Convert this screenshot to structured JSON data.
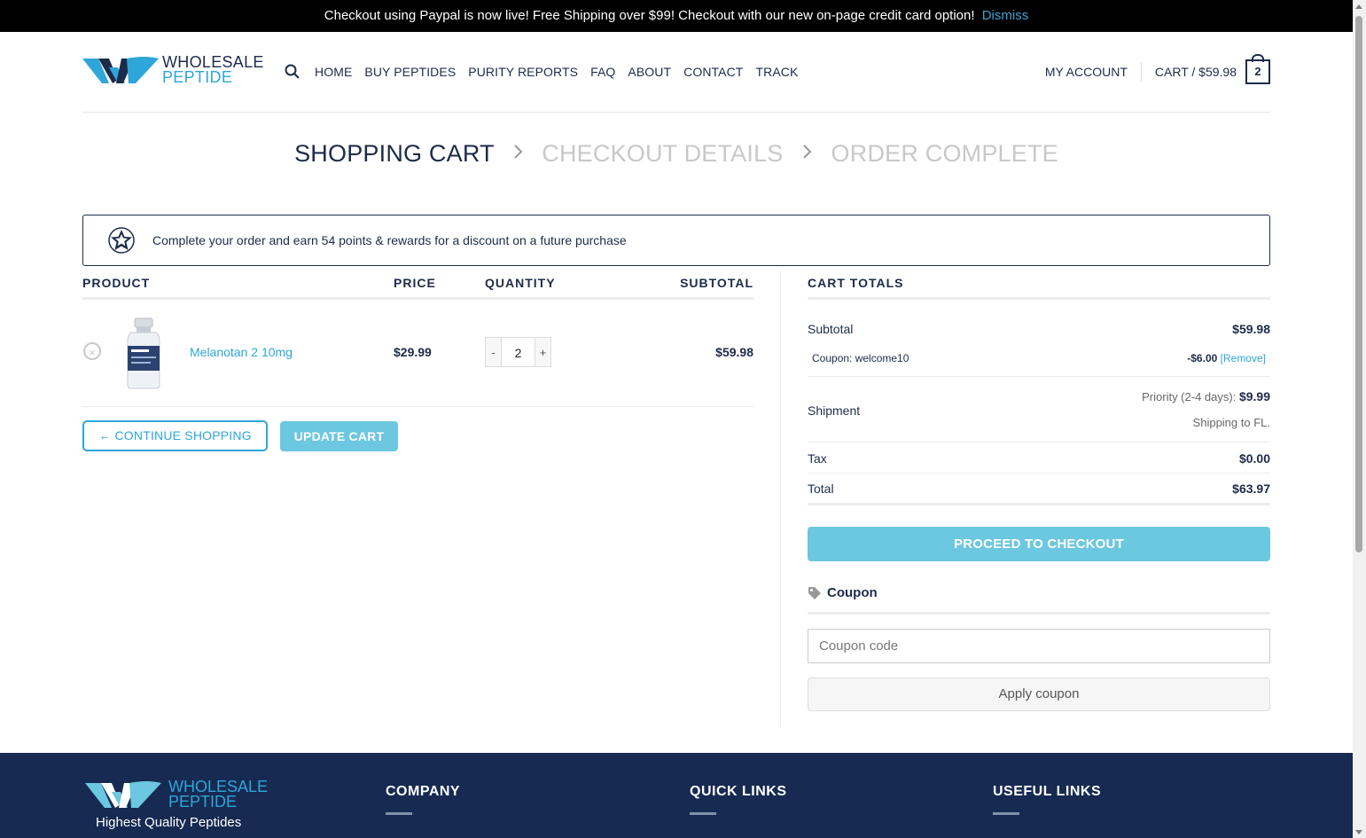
{
  "notice": {
    "text": "Checkout using Paypal is now live! Free Shipping over $99! Checkout with our new on-page credit card option!",
    "dismiss": "Dismiss"
  },
  "brand": {
    "line1": "WHOLESALE",
    "line2": "PEPTIDE"
  },
  "nav": {
    "items": [
      "HOME",
      "BUY PEPTIDES",
      "PURITY REPORTS",
      "FAQ",
      "ABOUT",
      "CONTACT",
      "TRACK"
    ],
    "account": "MY ACCOUNT",
    "cart": "CART / $59.98",
    "cart_count": "2"
  },
  "steps": {
    "step1": "SHOPPING CART",
    "step2": "CHECKOUT DETAILS",
    "step3": "ORDER COMPLETE",
    "separator": ">"
  },
  "rewards": {
    "text": "Complete your order and earn 54 points & rewards for a discount on a future purchase"
  },
  "cart": {
    "headers": {
      "product": "PRODUCT",
      "price": "PRICE",
      "quantity": "QUANTITY",
      "subtotal": "SUBTOTAL"
    },
    "items": [
      {
        "name": "Melanotan 2 10mg",
        "price": "$29.99",
        "qty": "2",
        "subtotal": "$59.98"
      }
    ],
    "qty_minus": "-",
    "qty_plus": "+",
    "remove_symbol": "×",
    "continue_label": "← CONTINUE SHOPPING",
    "update_label": "UPDATE CART"
  },
  "totals": {
    "heading": "CART TOTALS",
    "subtotal_label": "Subtotal",
    "subtotal_value": "$59.98",
    "coupon_label": "Coupon: welcome10",
    "coupon_amount": "-$6.00",
    "coupon_remove": "[Remove]",
    "shipment_label": "Shipment",
    "shipping_option": "Priority (2-4 days):",
    "shipping_price": "$9.99",
    "shipping_to": "Shipping to FL.",
    "tax_label": "Tax",
    "tax_value": "$0.00",
    "total_label": "Total",
    "total_value": "$63.97",
    "checkout_label": "PROCEED TO CHECKOUT",
    "coupon_heading": "Coupon",
    "coupon_placeholder": "Coupon code",
    "apply_label": "Apply coupon"
  },
  "footer": {
    "brand_line1": "WHOLESALE",
    "brand_line2": "PEPTIDE",
    "tagline": "Highest Quality Peptides",
    "col1": "COMPANY",
    "col2": "QUICK LINKS",
    "col3": "USEFUL LINKS"
  },
  "colors": {
    "navy": "#1d2b4a",
    "accent": "#2ea6d9",
    "button_light": "#6cc7e0",
    "footer_bg": "#162a52"
  }
}
